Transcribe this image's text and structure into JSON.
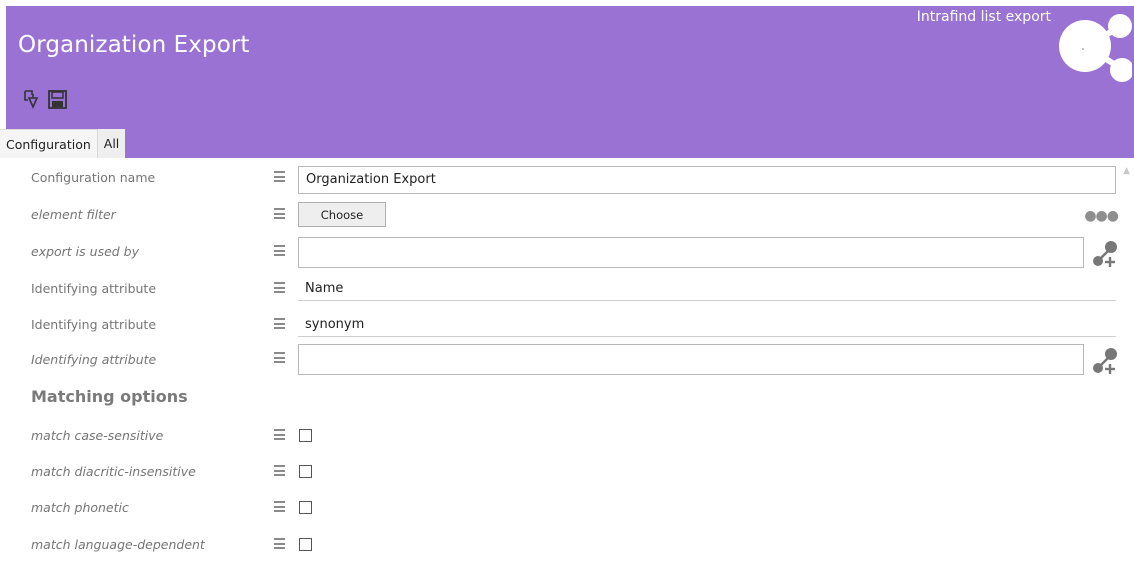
{
  "header": {
    "title": "Organization Export",
    "app_name": "Intrafind list export",
    "color": "#9a72d4"
  },
  "toolbar": {
    "icons": [
      "export-icon",
      "save-icon"
    ]
  },
  "tabs": [
    {
      "label": "Configuration",
      "active": true
    },
    {
      "label": "All",
      "active": false
    }
  ],
  "form": {
    "configuration_name": {
      "label": "Configuration name",
      "value": "Organization Export"
    },
    "element_filter": {
      "label": "element filter",
      "button": "Choose"
    },
    "export_used_by": {
      "label": "export is used by",
      "value": ""
    },
    "identifying_1": {
      "label": "Identifying attribute",
      "value": "Name"
    },
    "identifying_2": {
      "label": "Identifying attribute",
      "value": "synonym"
    },
    "identifying_3": {
      "label": "Identifying attribute",
      "value": ""
    }
  },
  "matching": {
    "heading": "Matching options",
    "options": [
      {
        "label": "match case-sensitive",
        "checked": false
      },
      {
        "label": "match diacritic-insensitive",
        "checked": false
      },
      {
        "label": "match phonetic",
        "checked": false
      },
      {
        "label": "match language-dependent",
        "checked": false
      }
    ]
  }
}
